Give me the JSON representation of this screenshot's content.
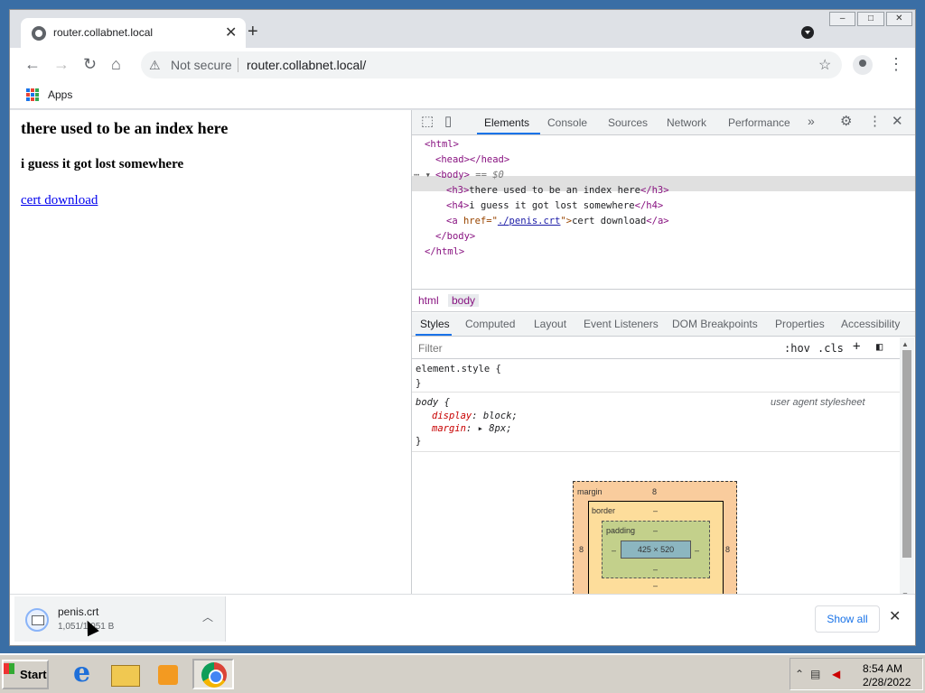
{
  "tab": {
    "title": "router.collabnet.local",
    "close": "✕",
    "new_tab": "+"
  },
  "window_buttons": [
    "–",
    "□",
    "✕"
  ],
  "toolbar": {
    "not_secure": "Not secure",
    "url": "router.collabnet.local/"
  },
  "bookmarks": {
    "apps_label": "Apps"
  },
  "page": {
    "h3": "there used to be an index here",
    "h4": "i guess it got lost somewhere",
    "link": "cert download"
  },
  "devtools": {
    "tabs": [
      "Elements",
      "Console",
      "Sources",
      "Network",
      "Performance"
    ],
    "more": "»",
    "dom": {
      "html_open": "<html>",
      "head": "<head></head>",
      "body_open": "<body>",
      "body_marker": "== $0",
      "h3_open": "<h3>",
      "h3_text": "there used to be an index here",
      "h3_close": "</h3>",
      "h4_open": "<h4>",
      "h4_text": "i guess it got lost somewhere",
      "h4_close": "</h4>",
      "a_open": "<a ",
      "a_attr": "href=",
      "a_quote_open": "\"",
      "a_href": "./penis.crt",
      "a_quote_close": "\">",
      "a_text": "cert download",
      "a_close": "</a>",
      "body_close": "</body>",
      "html_close": "</html>"
    },
    "crumbs": [
      "html",
      "body"
    ],
    "subtabs": [
      "Styles",
      "Computed",
      "Layout",
      "Event Listeners",
      "DOM Breakpoints",
      "Properties",
      "Accessibility"
    ],
    "filter_placeholder": "Filter",
    "hov": ":hov",
    "cls": ".cls",
    "rules": {
      "element_style": "element.style {",
      "close": "}",
      "body_selector": "body {",
      "origin": "user agent stylesheet",
      "display_prop": "display",
      "display_val": ": block;",
      "margin_prop": "margin",
      "margin_val": ": ▸ 8px;"
    },
    "box_model": {
      "margin_label": "margin",
      "margin_top": "8",
      "margin_left": "8",
      "margin_right": "8",
      "border_label": "border",
      "border_top": "–",
      "border_bottom": "–",
      "border_side": "–",
      "padding_label": "padding",
      "padding_top": "–",
      "padding_bottom": "–",
      "padding_side": "–",
      "content": "425 × 520"
    }
  },
  "download": {
    "filename": "penis.crt",
    "size": "1,051/1,051 B",
    "show_all": "Show all"
  },
  "taskbar": {
    "start": "Start",
    "time": "8:54 AM",
    "date": "2/28/2022"
  }
}
